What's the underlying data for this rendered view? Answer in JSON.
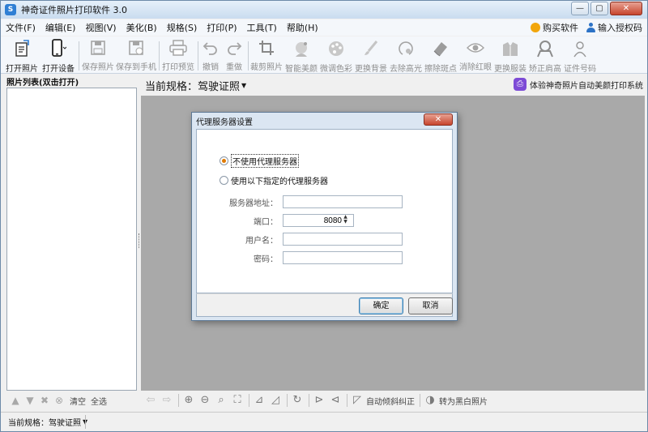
{
  "window": {
    "title": "神奇证件照片打印软件 3.0",
    "app_icon": "S"
  },
  "window_controls": {
    "minimize": "—",
    "maximize": "▢",
    "close": "✕"
  },
  "menu": {
    "items": [
      "文件(F)",
      "编辑(E)",
      "视图(V)",
      "美化(B)",
      "规格(S)",
      "打印(P)",
      "工具(T)",
      "帮助(H)"
    ],
    "buy": "购买软件",
    "license": "输入授权码"
  },
  "toolbar": {
    "buttons": [
      {
        "label": "打开照片",
        "icon": "open-photo-icon"
      },
      {
        "label": "打开设备",
        "icon": "phone-device-icon"
      },
      {
        "label": "保存照片",
        "icon": "save-icon"
      },
      {
        "label": "保存到手机",
        "icon": "save-to-phone-icon"
      },
      {
        "label": "打印预览",
        "icon": "printer-icon"
      },
      {
        "label": "撤销",
        "icon": "undo-icon"
      },
      {
        "label": "重做",
        "icon": "redo-icon"
      },
      {
        "label": "裁剪照片",
        "icon": "crop-icon"
      },
      {
        "label": "智能美颜",
        "icon": "beauty-icon"
      },
      {
        "label": "微调色彩",
        "icon": "palette-icon"
      },
      {
        "label": "更换背景",
        "icon": "background-icon"
      },
      {
        "label": "去除高光",
        "icon": "highlight-remove-icon"
      },
      {
        "label": "擦除斑点",
        "icon": "eraser-icon"
      },
      {
        "label": "消除红眼",
        "icon": "eye-icon"
      },
      {
        "label": "更换服装",
        "icon": "clothes-icon"
      },
      {
        "label": "矫正肩高",
        "icon": "shoulder-icon"
      },
      {
        "label": "证件号码",
        "icon": "id-person-icon"
      }
    ]
  },
  "left_panel": {
    "header": "照片列表(双击打开)",
    "clear_label": "清空",
    "select_all_label": "全选"
  },
  "right_panel": {
    "spec_prefix": "当前规格：",
    "spec_value": "驾驶证照",
    "promo_text": "体验神奇照片自动美颜打印系统",
    "bottom": {
      "auto_tilt_label": "自动倾斜纠正",
      "grayscale_label": "转为黑白照片"
    }
  },
  "statusbar": {
    "text": "当前规格：驾驶证照"
  },
  "dialog": {
    "title": "代理服务器设置",
    "option_no_proxy": "不使用代理服务器",
    "option_use_proxy": "使用以下指定的代理服务器",
    "selected_option": "不使用代理服务器",
    "fields": {
      "server_label": "服务器地址：",
      "server_value": "",
      "port_label": "端口：",
      "port_value": "8080",
      "username_label": "用户名：",
      "username_value": "",
      "password_label": "密码：",
      "password_value": ""
    },
    "ok_label": "确定",
    "cancel_label": "取消"
  },
  "colors": {
    "canvas": "#a9a9a9",
    "accent": "#2f7fd4",
    "radio_selected": "#e07a00"
  }
}
